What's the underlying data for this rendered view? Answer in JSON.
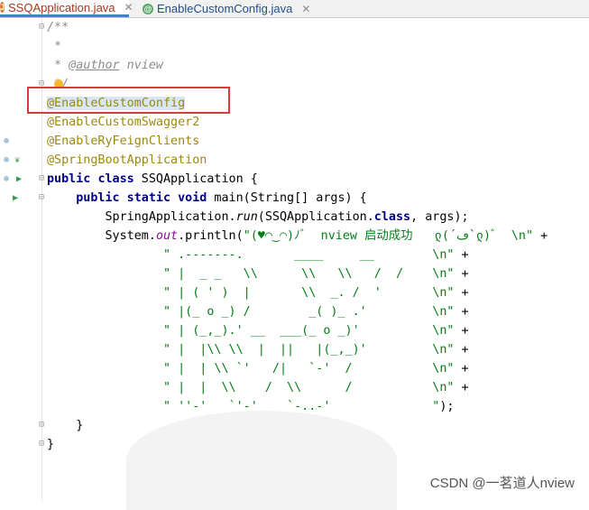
{
  "tabs": [
    {
      "label": "SSQApplication.java",
      "icon": "J",
      "icon_color": "#e17a22",
      "active": true
    },
    {
      "label": "EnableCustomConfig.java",
      "icon": "@",
      "icon_color": "#59a869",
      "active": false
    }
  ],
  "code": {
    "line1": "/**",
    "line2": " *",
    "line3_prefix": " * ",
    "line3_tag": "@author",
    "line3_rest": " nview",
    "line4": " */",
    "anno1": "@EnableCustomConfig",
    "anno2": "@EnableCustomSwagger2",
    "anno3": "@EnableRyFeignClients",
    "anno4": "@SpringBootApplication",
    "class_kw1": "public",
    "class_kw2": "class",
    "class_name": " SSQApplication {",
    "main_kw": "    public static void",
    "main_rest": " main(String[] args) {",
    "run_prefix": "        SpringApplication.",
    "run_method": "run",
    "run_rest": "(SSQApplication.",
    "run_class_kw": "class",
    "run_end": ", args);",
    "println_prefix": "        System.",
    "println_out": "out",
    "println_rest": ".println(",
    "banner": [
      "\"(♥◠‿◠)ﾉﾞ  nview 启动成功   ლ(´ڡ`ლ)ﾞ  \\n\"",
      "\" .-------.       ____     __        \\n\"",
      "\" |  _ _   \\\\      \\\\   \\\\   /  /    \\n\"",
      "\" | ( ' )  |       \\\\  _. /  '       \\n\"",
      "\" |(_ o _) /        _( )_ .'         \\n\"",
      "\" | (_,_).' __  ___(_ o _)'          \\n\"",
      "\" |  |\\\\ \\\\  |  ||   |(_,_)'         \\n\"",
      "\" |  | \\\\ `'   /|   `-'  /           \\n\"",
      "\" |  |  \\\\    /  \\\\      /           \\n\"",
      "\" ''-'   `'-'    `-..-'              \""
    ],
    "plus": " +",
    "end": ");",
    "close_method": "    }",
    "close_class": "}"
  },
  "watermark": "CSDN @一茗道人nview"
}
